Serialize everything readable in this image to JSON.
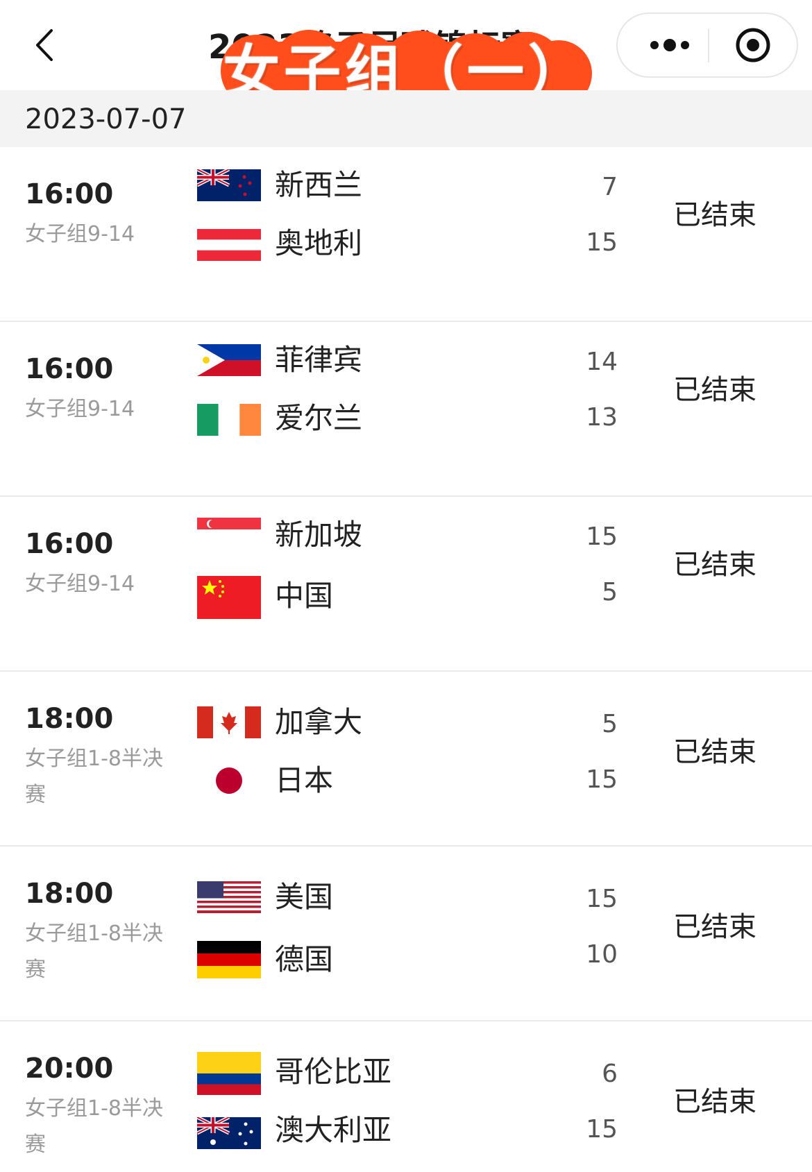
{
  "nav": {
    "title": "2023格子足球锦标赛...",
    "sticker_text": "女子组（一）"
  },
  "icons": {
    "back": "back-chevron-icon",
    "more": "more-dots-icon",
    "target": "target-circle-icon"
  },
  "colors": {
    "sticker": "#ff4e1c",
    "date_bar_bg": "#f3f3f3"
  },
  "date": "2023-07-07",
  "matches": [
    {
      "time": "16:00",
      "stage": "女子组9-14",
      "status": "已结束",
      "team1": {
        "name": "新西兰",
        "score": "7",
        "flag": "nz-flag"
      },
      "team2": {
        "name": "奥地利",
        "score": "15",
        "flag": "austria-flag"
      }
    },
    {
      "time": "16:00",
      "stage": "女子组9-14",
      "status": "已结束",
      "team1": {
        "name": "菲律宾",
        "score": "14",
        "flag": "philippines-flag"
      },
      "team2": {
        "name": "爱尔兰",
        "score": "13",
        "flag": "ireland-flag"
      }
    },
    {
      "time": "16:00",
      "stage": "女子组9-14",
      "status": "已结束",
      "team1": {
        "name": "新加坡",
        "score": "15",
        "flag": "singapore-flag"
      },
      "team2": {
        "name": "中国",
        "score": "5",
        "flag": "china-flag"
      }
    },
    {
      "time": "18:00",
      "stage": "女子组1-8半决赛",
      "status": "已结束",
      "team1": {
        "name": "加拿大",
        "score": "5",
        "flag": "canada-flag"
      },
      "team2": {
        "name": "日本",
        "score": "15",
        "flag": "japan-flag"
      }
    },
    {
      "time": "18:00",
      "stage": "女子组1-8半决赛",
      "status": "已结束",
      "team1": {
        "name": "美国",
        "score": "15",
        "flag": "usa-flag"
      },
      "team2": {
        "name": "德国",
        "score": "10",
        "flag": "germany-flag"
      }
    },
    {
      "time": "20:00",
      "stage": "女子组1-8半决赛",
      "status": "已结束",
      "team1": {
        "name": "哥伦比亚",
        "score": "6",
        "flag": "colombia-flag"
      },
      "team2": {
        "name": "澳大利亚",
        "score": "15",
        "flag": "australia-flag"
      }
    }
  ]
}
